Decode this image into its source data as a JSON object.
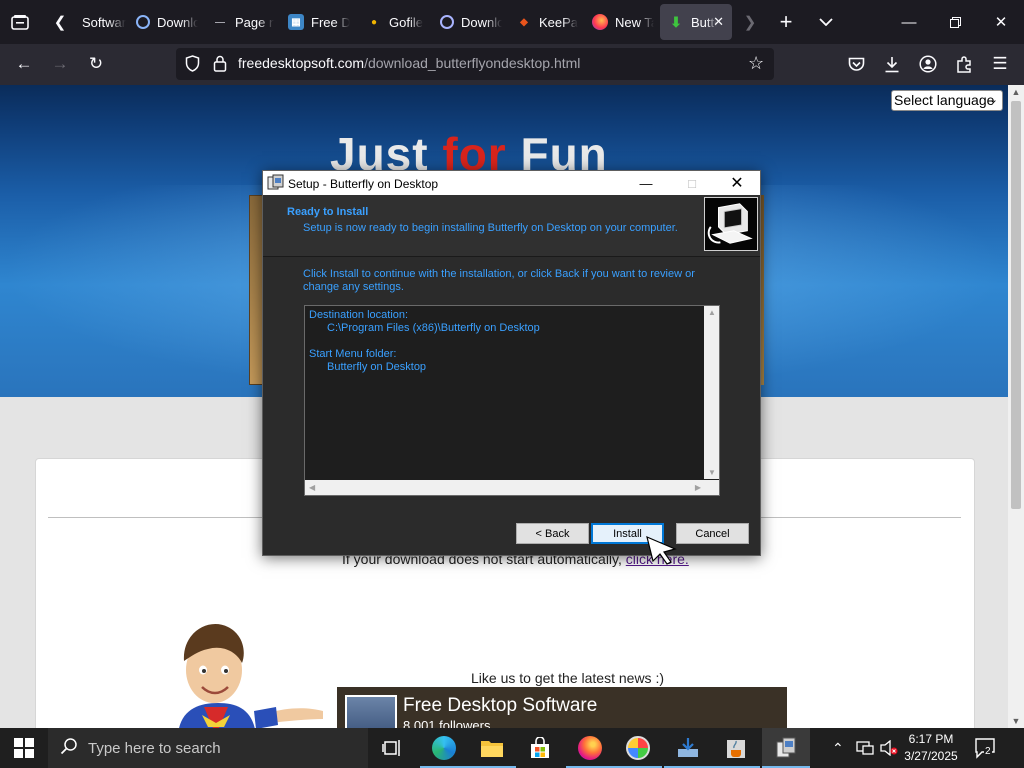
{
  "browser": {
    "tabs": [
      {
        "label": "Software"
      },
      {
        "label": "Download"
      },
      {
        "label": "Page not"
      },
      {
        "label": "Free Desktop"
      },
      {
        "label": "Gofile"
      },
      {
        "label": "Download"
      },
      {
        "label": "KeePass"
      },
      {
        "label": "New Tab"
      },
      {
        "label": "Butterfly"
      }
    ],
    "url_domain": "freedesktopsoft.com",
    "url_path": "/download_butterflyondesktop.html"
  },
  "page": {
    "title_part1": "Just ",
    "title_part2": "for",
    "title_part3": " Fun",
    "language_select": "Select language",
    "download_note": "If your download does not start automatically, ",
    "download_link": "click here.",
    "like_note": "Like us to get the latest news :)",
    "fb_name": "Free Desktop Software",
    "fb_followers": "8,001 followers"
  },
  "dialog": {
    "title": "Setup - Butterfly on Desktop",
    "heading": "Ready to Install",
    "subheading": "Setup is now ready to begin installing Butterfly on Desktop on your computer.",
    "instructions": "Click Install to continue with the installation, or click Back if you want to review or change any settings.",
    "memo_dest_label": "Destination location:",
    "memo_dest_value": "C:\\Program Files (x86)\\Butterfly on Desktop",
    "memo_start_label": "Start Menu folder:",
    "memo_start_value": "Butterfly on Desktop",
    "back_label": "< Back",
    "install_label": "Install",
    "cancel_label": "Cancel"
  },
  "taskbar": {
    "search_placeholder": "Type here to search",
    "time": "6:17 PM",
    "date": "3/27/2025",
    "notification_count": "2"
  },
  "colors": {
    "dialog_text": "#3aa0ff",
    "title_red": "#d8241c",
    "taskbar_bg": "#1f1f1f"
  }
}
